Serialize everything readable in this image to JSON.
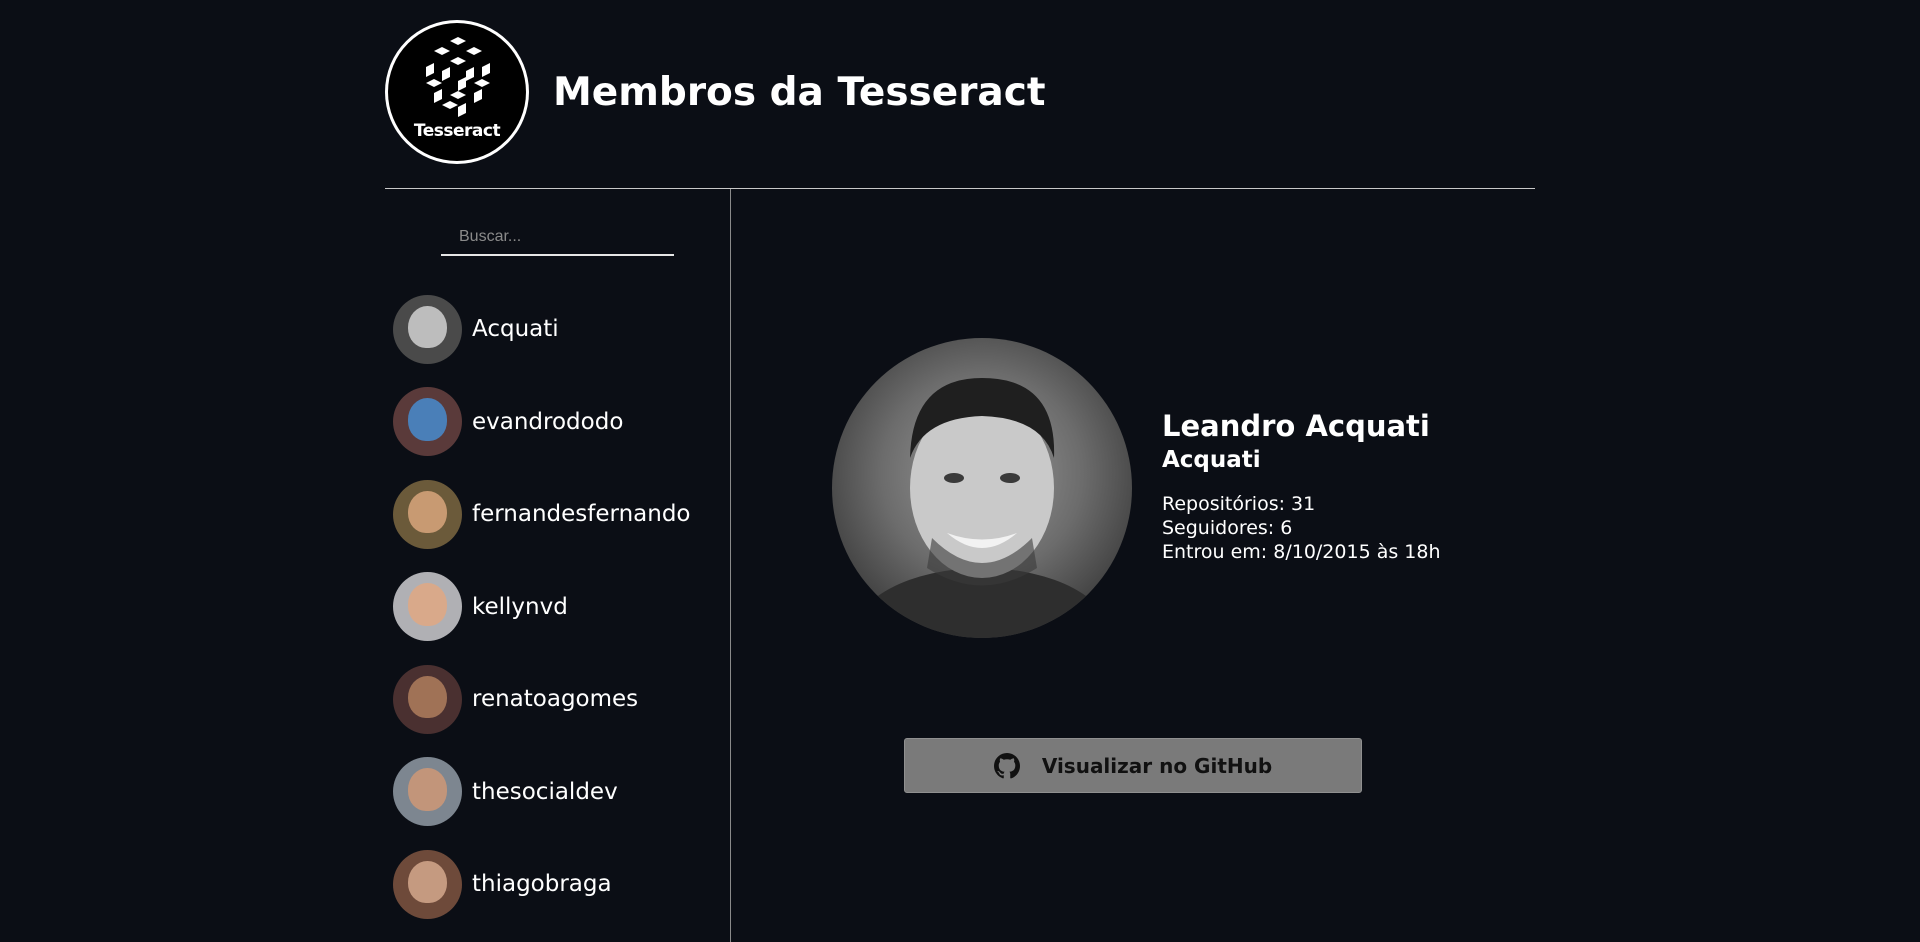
{
  "header": {
    "logo_text": "Tesseract",
    "title": "Membros da Tesseract"
  },
  "search": {
    "placeholder": "Buscar...",
    "value": ""
  },
  "members": [
    {
      "login": "Acquati",
      "avatar_bg": "#4a4a4a",
      "avatar_face": "#bdbdbd"
    },
    {
      "login": "evandrododo",
      "avatar_bg": "#5a3a3a",
      "avatar_face": "#4a7fb8"
    },
    {
      "login": "fernandesfernando",
      "avatar_bg": "#6b5a3a",
      "avatar_face": "#c89a72"
    },
    {
      "login": "kellynvd",
      "avatar_bg": "#b0b0b4",
      "avatar_face": "#d9a98a"
    },
    {
      "login": "renatoagomes",
      "avatar_bg": "#4a3030",
      "avatar_face": "#a07256"
    },
    {
      "login": "thesocialdev",
      "avatar_bg": "#7d8690",
      "avatar_face": "#c2957a"
    },
    {
      "login": "thiagobraga",
      "avatar_bg": "#6e4a3a",
      "avatar_face": "#c59a80"
    }
  ],
  "profile": {
    "name": "Leandro Acquati",
    "login": "Acquati",
    "repos_text": "Repositórios: 31",
    "followers_text": "Seguidores: 6",
    "joined_text": "Entrou em: 8/10/2015 às 18h",
    "github_button_label": "Visualizar no GitHub",
    "github_icon": "github-icon"
  }
}
